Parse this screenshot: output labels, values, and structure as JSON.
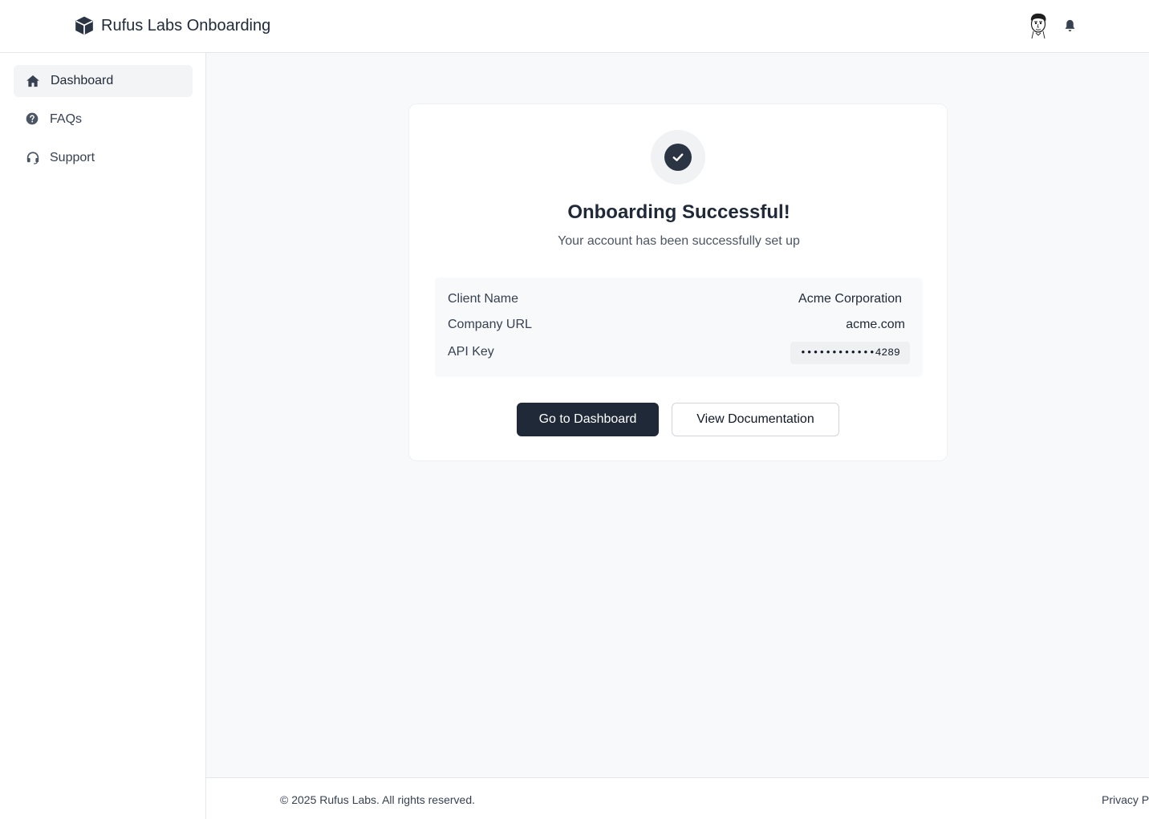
{
  "header": {
    "app_title": "Rufus Labs Onboarding",
    "logo_icon": "cube-icon",
    "avatar_icon": "cartoon-face-avatar",
    "notification_icon": "bell-icon"
  },
  "sidebar": {
    "items": [
      {
        "label": "Dashboard",
        "icon": "home-icon",
        "active": true
      },
      {
        "label": "FAQs",
        "icon": "question-circle-icon",
        "active": false
      },
      {
        "label": "Support",
        "icon": "headset-icon",
        "active": false
      }
    ]
  },
  "card": {
    "status_icon": "check-circle-icon",
    "title": "Onboarding Successful!",
    "subtitle": "Your account has been successfully set up",
    "details": {
      "client_name_label": "Client Name",
      "client_name_value": "Acme Corporation",
      "company_url_label": "Company URL",
      "company_url_value": "acme.com",
      "api_key_label": "API Key",
      "api_key_value": "••••••••••••4289"
    },
    "primary_button": "Go to Dashboard",
    "secondary_button": "View Documentation"
  },
  "footer": {
    "copyright": "© 2025 Rufus Labs. All rights reserved.",
    "link": "Privacy P"
  },
  "colors": {
    "primary": "#1f2937",
    "page_background": "#f8f9fb",
    "active_nav_background": "#f3f4f6"
  }
}
